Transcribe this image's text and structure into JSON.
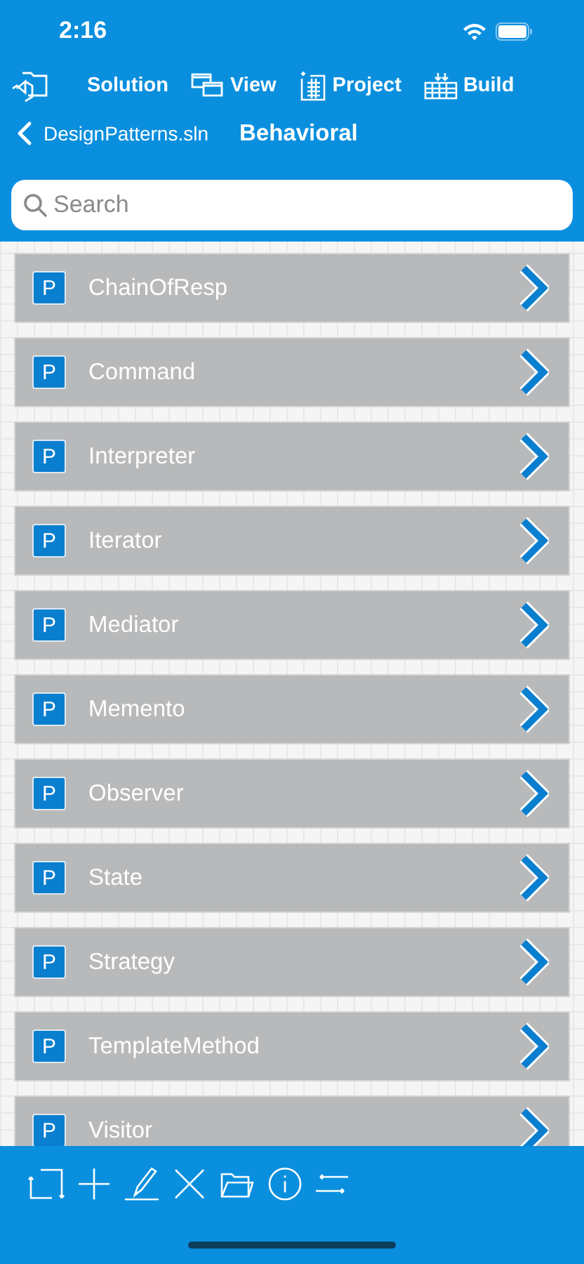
{
  "status_bar": {
    "time": "2:16"
  },
  "toolbar": [
    {
      "label": "Solution",
      "kind": "solution"
    },
    {
      "label": "View",
      "kind": "view"
    },
    {
      "label": "Project",
      "kind": "project"
    },
    {
      "label": "Build",
      "kind": "build"
    }
  ],
  "nav": {
    "back": "DesignPatterns.sln",
    "title": "Behavioral"
  },
  "search": {
    "placeholder": "Search"
  },
  "items": [
    {
      "badge": "P",
      "name": "ChainOfResp"
    },
    {
      "badge": "P",
      "name": "Command"
    },
    {
      "badge": "P",
      "name": "Interpreter"
    },
    {
      "badge": "P",
      "name": "Iterator"
    },
    {
      "badge": "P",
      "name": "Mediator"
    },
    {
      "badge": "P",
      "name": "Memento"
    },
    {
      "badge": "P",
      "name": "Observer"
    },
    {
      "badge": "P",
      "name": "State"
    },
    {
      "badge": "P",
      "name": "Strategy"
    },
    {
      "badge": "P",
      "name": "TemplateMethod"
    },
    {
      "badge": "P",
      "name": "Visitor"
    }
  ],
  "bottom_tools": [
    {
      "kind": "refresh"
    },
    {
      "kind": "add"
    },
    {
      "kind": "edit"
    },
    {
      "kind": "delete"
    },
    {
      "kind": "folder"
    },
    {
      "kind": "info"
    },
    {
      "kind": "swap"
    }
  ]
}
